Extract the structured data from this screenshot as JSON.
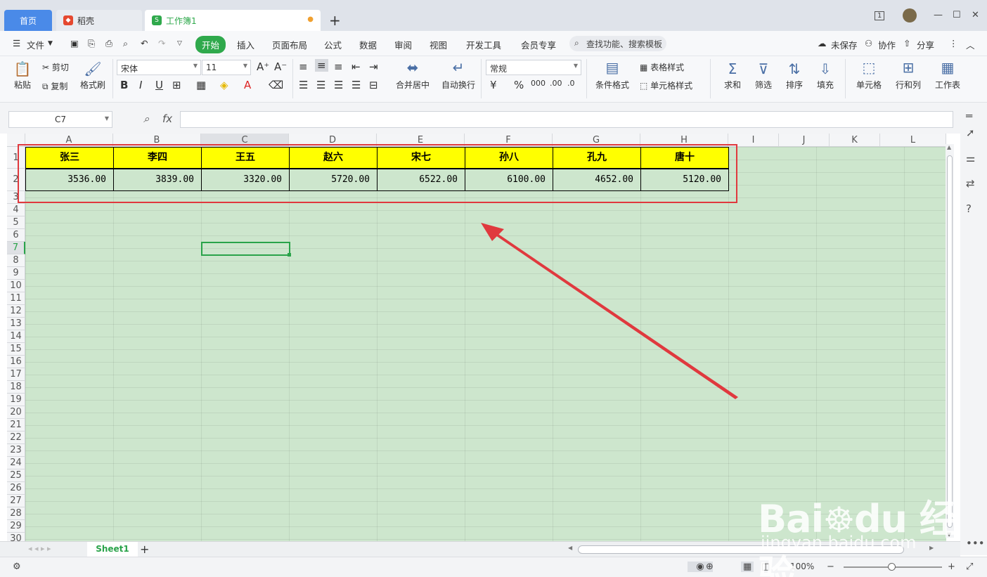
{
  "titlebar": {
    "tabs": [
      {
        "label": "首页"
      },
      {
        "label": "稻壳"
      },
      {
        "label": "工作簿1"
      }
    ],
    "page_badge": "1"
  },
  "menu": {
    "file": "文件",
    "items": [
      "开始",
      "插入",
      "页面布局",
      "公式",
      "数据",
      "审阅",
      "视图",
      "开发工具",
      "会员专享"
    ],
    "search": "查找功能、搜索模板",
    "unsaved": "未保存",
    "collab": "协作",
    "share": "分享"
  },
  "ribbon": {
    "paste": "粘贴",
    "cut": "剪切",
    "copy": "复制",
    "format_painter": "格式刷",
    "font": "宋体",
    "font_size": "11",
    "merge_center": "合并居中",
    "auto_wrap": "自动换行",
    "number_format": "常规",
    "cond_format": "条件格式",
    "table_style": "表格样式",
    "cell_style": "单元格样式",
    "sum": "求和",
    "filter": "筛选",
    "sort": "排序",
    "fill": "填充",
    "cell": "单元格",
    "row_col": "行和列",
    "worksheet": "工作表"
  },
  "formula_bar": {
    "name_box": "C7",
    "fx": "fx",
    "content": ""
  },
  "sheet": {
    "columns": [
      "A",
      "B",
      "C",
      "D",
      "E",
      "F",
      "G",
      "H",
      "I",
      "J",
      "K",
      "L"
    ],
    "rows": [
      "1",
      "2",
      "3",
      "4",
      "5",
      "6",
      "7",
      "8",
      "9",
      "10",
      "11",
      "12",
      "13",
      "14",
      "15",
      "16",
      "17",
      "18",
      "19",
      "20",
      "21",
      "22",
      "23",
      "24",
      "25",
      "26",
      "27",
      "28",
      "29",
      "30"
    ],
    "headers": [
      "张三",
      "李四",
      "王五",
      "赵六",
      "宋七",
      "孙八",
      "孔九",
      "唐十"
    ],
    "values": [
      "3536.00",
      "3839.00",
      "3320.00",
      "5720.00",
      "6522.00",
      "6100.00",
      "4652.00",
      "5120.00"
    ],
    "selected_cell": "C7"
  },
  "sheet_tabs": {
    "active": "Sheet1"
  },
  "status": {
    "zoom": "100%"
  },
  "watermark": {
    "brand": "Bai du 经验",
    "url": "jingyan.baidu.com"
  },
  "colors": {
    "accent_green": "#2fa94c",
    "header_fill": "#ffff00",
    "eye_protection_bg": "#cde6cd",
    "annotation_red": "#e0393e"
  }
}
